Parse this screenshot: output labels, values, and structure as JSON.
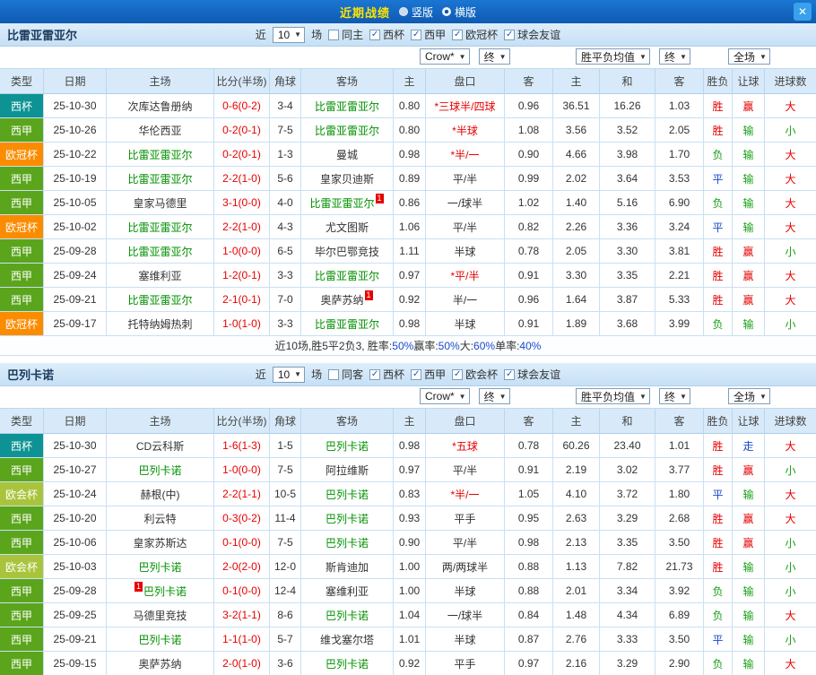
{
  "topbar": {
    "title": "近期战绩",
    "radios": [
      {
        "label": "竖版",
        "selected": false
      },
      {
        "label": "横版",
        "selected": true
      }
    ],
    "close_icon": "✕"
  },
  "table_headers": [
    "类型",
    "日期",
    "主场",
    "比分(半场)",
    "角球",
    "客场",
    "主",
    "盘口",
    "客",
    "主",
    "和",
    "客",
    "胜负",
    "让球",
    "进球数"
  ],
  "colors": {
    "win_red": "#e60000",
    "lose_green": "#16a016",
    "draw_blue": "#1a49cc",
    "focus_team_green": "#009000",
    "badge_cup": "#0d9394",
    "badge_liga": "#5ba51c",
    "badge_ucl": "#fb8c00",
    "badge_uecl": "#a9c43c",
    "title_yellow": "#ffe400"
  },
  "sections": [
    {
      "team": "比雷亚雷亚尔",
      "filters": {
        "near_label": "近",
        "count": "10",
        "games_label": "场",
        "same": {
          "label": "同主",
          "checked": false
        },
        "leagues": [
          {
            "label": "西杯",
            "checked": true
          },
          {
            "label": "西甲",
            "checked": true
          },
          {
            "label": "欧冠杯",
            "checked": true
          },
          {
            "label": "球会友谊",
            "checked": true
          }
        ]
      },
      "dropdowns": {
        "company": "Crow*",
        "final_asian": "终",
        "avg": "胜平负均值",
        "final_euro": "终",
        "scope": "全场"
      },
      "rows": [
        {
          "type": "西杯",
          "tcls": "cup",
          "date": "25-10-30",
          "home": "次库达鲁册纳",
          "hf": false,
          "hpre": "",
          "hpost": "",
          "score": "0-6(0-2)",
          "corner": "3-4",
          "away": "比雷亚雷亚尔",
          "af": true,
          "apre": "",
          "apost": "",
          "ah": "0.80",
          "hc": "*三球半/四球",
          "hcr": true,
          "aa": "0.96",
          "eh": "36.51",
          "ed": "16.26",
          "ea": "1.03",
          "res": "胜",
          "resc": "r",
          "let": "赢",
          "letc": "r",
          "goal": "大",
          "goalc": "r"
        },
        {
          "type": "西甲",
          "tcls": "liga",
          "date": "25-10-26",
          "home": "华伦西亚",
          "hf": false,
          "hpre": "",
          "hpost": "",
          "score": "0-2(0-1)",
          "corner": "7-5",
          "away": "比雷亚雷亚尔",
          "af": true,
          "apre": "",
          "apost": "",
          "ah": "0.80",
          "hc": "*半球",
          "hcr": true,
          "aa": "1.08",
          "eh": "3.56",
          "ed": "3.52",
          "ea": "2.05",
          "res": "胜",
          "resc": "r",
          "let": "输",
          "letc": "g",
          "goal": "小",
          "goalc": "g"
        },
        {
          "type": "欧冠杯",
          "tcls": "ucl",
          "date": "25-10-22",
          "home": "比雷亚雷亚尔",
          "hf": true,
          "hpre": "",
          "hpost": "",
          "score": "0-2(0-1)",
          "corner": "1-3",
          "away": "曼城",
          "af": false,
          "apre": "",
          "apost": "",
          "ah": "0.98",
          "hc": "*半/一",
          "hcr": true,
          "aa": "0.90",
          "eh": "4.66",
          "ed": "3.98",
          "ea": "1.70",
          "res": "负",
          "resc": "g",
          "let": "输",
          "letc": "g",
          "goal": "大",
          "goalc": "r"
        },
        {
          "type": "西甲",
          "tcls": "liga",
          "date": "25-10-19",
          "home": "比雷亚雷亚尔",
          "hf": true,
          "hpre": "",
          "hpost": "",
          "score": "2-2(1-0)",
          "corner": "5-6",
          "away": "皇家贝迪斯",
          "af": false,
          "apre": "",
          "apost": "",
          "ah": "0.89",
          "hc": "平/半",
          "hcr": false,
          "aa": "0.99",
          "eh": "2.02",
          "ed": "3.64",
          "ea": "3.53",
          "res": "平",
          "resc": "b",
          "let": "输",
          "letc": "g",
          "goal": "大",
          "goalc": "r"
        },
        {
          "type": "西甲",
          "tcls": "liga",
          "date": "25-10-05",
          "home": "皇家马德里",
          "hf": false,
          "hpre": "",
          "hpost": "",
          "score": "3-1(0-0)",
          "corner": "4-0",
          "away": "比雷亚雷亚尔",
          "af": true,
          "apre": "",
          "apost": "1",
          "ah": "0.86",
          "hc": "一/球半",
          "hcr": false,
          "aa": "1.02",
          "eh": "1.40",
          "ed": "5.16",
          "ea": "6.90",
          "res": "负",
          "resc": "g",
          "let": "输",
          "letc": "g",
          "goal": "大",
          "goalc": "r"
        },
        {
          "type": "欧冠杯",
          "tcls": "ucl",
          "date": "25-10-02",
          "home": "比雷亚雷亚尔",
          "hf": true,
          "hpre": "",
          "hpost": "",
          "score": "2-2(1-0)",
          "corner": "4-3",
          "away": "尤文图斯",
          "af": false,
          "apre": "",
          "apost": "",
          "ah": "1.06",
          "hc": "平/半",
          "hcr": false,
          "aa": "0.82",
          "eh": "2.26",
          "ed": "3.36",
          "ea": "3.24",
          "res": "平",
          "resc": "b",
          "let": "输",
          "letc": "g",
          "goal": "大",
          "goalc": "r"
        },
        {
          "type": "西甲",
          "tcls": "liga",
          "date": "25-09-28",
          "home": "比雷亚雷亚尔",
          "hf": true,
          "hpre": "",
          "hpost": "",
          "score": "1-0(0-0)",
          "corner": "6-5",
          "away": "毕尔巴鄂竞技",
          "af": false,
          "apre": "",
          "apost": "",
          "ah": "1.11",
          "hc": "半球",
          "hcr": false,
          "aa": "0.78",
          "eh": "2.05",
          "ed": "3.30",
          "ea": "3.81",
          "res": "胜",
          "resc": "r",
          "let": "赢",
          "letc": "r",
          "goal": "小",
          "goalc": "g"
        },
        {
          "type": "西甲",
          "tcls": "liga",
          "date": "25-09-24",
          "home": "塞维利亚",
          "hf": false,
          "hpre": "",
          "hpost": "",
          "score": "1-2(0-1)",
          "corner": "3-3",
          "away": "比雷亚雷亚尔",
          "af": true,
          "apre": "",
          "apost": "",
          "ah": "0.97",
          "hc": "*平/半",
          "hcr": true,
          "aa": "0.91",
          "eh": "3.30",
          "ed": "3.35",
          "ea": "2.21",
          "res": "胜",
          "resc": "r",
          "let": "赢",
          "letc": "r",
          "goal": "大",
          "goalc": "r"
        },
        {
          "type": "西甲",
          "tcls": "liga",
          "date": "25-09-21",
          "home": "比雷亚雷亚尔",
          "hf": true,
          "hpre": "",
          "hpost": "",
          "score": "2-1(0-1)",
          "corner": "7-0",
          "away": "奥萨苏纳",
          "af": false,
          "apre": "",
          "apost": "1",
          "ah": "0.92",
          "hc": "半/一",
          "hcr": false,
          "aa": "0.96",
          "eh": "1.64",
          "ed": "3.87",
          "ea": "5.33",
          "res": "胜",
          "resc": "r",
          "let": "赢",
          "letc": "r",
          "goal": "大",
          "goalc": "r"
        },
        {
          "type": "欧冠杯",
          "tcls": "ucl",
          "date": "25-09-17",
          "home": "托特纳姆热刺",
          "hf": false,
          "hpre": "",
          "hpost": "",
          "score": "1-0(1-0)",
          "corner": "3-3",
          "away": "比雷亚雷亚尔",
          "af": true,
          "apre": "",
          "apost": "",
          "ah": "0.98",
          "hc": "半球",
          "hcr": false,
          "aa": "0.91",
          "eh": "1.89",
          "ed": "3.68",
          "ea": "3.99",
          "res": "负",
          "resc": "g",
          "let": "输",
          "letc": "g",
          "goal": "小",
          "goalc": "g"
        }
      ],
      "summary": [
        {
          "text": "近10场,胜5平2负3, 胜率:",
          "cls": "dark"
        },
        {
          "text": "50%",
          "cls": "blue"
        },
        {
          "text": " 赢率:",
          "cls": "dark"
        },
        {
          "text": "50%",
          "cls": "blue"
        },
        {
          "text": " 大:",
          "cls": "dark"
        },
        {
          "text": "60%",
          "cls": "blue"
        },
        {
          "text": " 单率:",
          "cls": "dark"
        },
        {
          "text": "40%",
          "cls": "blue"
        }
      ]
    },
    {
      "team": "巴列卡诺",
      "filters": {
        "near_label": "近",
        "count": "10",
        "games_label": "场",
        "same": {
          "label": "同客",
          "checked": false
        },
        "leagues": [
          {
            "label": "西杯",
            "checked": true
          },
          {
            "label": "西甲",
            "checked": true
          },
          {
            "label": "欧会杯",
            "checked": true
          },
          {
            "label": "球会友谊",
            "checked": true
          }
        ]
      },
      "dropdowns": {
        "company": "Crow*",
        "final_asian": "终",
        "avg": "胜平负均值",
        "final_euro": "终",
        "scope": "全场"
      },
      "rows": [
        {
          "type": "西杯",
          "tcls": "cup",
          "date": "25-10-30",
          "home": "CD云科斯",
          "hf": false,
          "hpre": "",
          "hpost": "",
          "score": "1-6(1-3)",
          "corner": "1-5",
          "away": "巴列卡诺",
          "af": true,
          "apre": "",
          "apost": "",
          "ah": "0.98",
          "hc": "*五球",
          "hcr": true,
          "aa": "0.78",
          "eh": "60.26",
          "ed": "23.40",
          "ea": "1.01",
          "res": "胜",
          "resc": "r",
          "let": "走",
          "letc": "b",
          "goal": "大",
          "goalc": "r"
        },
        {
          "type": "西甲",
          "tcls": "liga",
          "date": "25-10-27",
          "home": "巴列卡诺",
          "hf": true,
          "hpre": "",
          "hpost": "",
          "score": "1-0(0-0)",
          "corner": "7-5",
          "away": "阿拉维斯",
          "af": false,
          "apre": "",
          "apost": "",
          "ah": "0.97",
          "hc": "平/半",
          "hcr": false,
          "aa": "0.91",
          "eh": "2.19",
          "ed": "3.02",
          "ea": "3.77",
          "res": "胜",
          "resc": "r",
          "let": "赢",
          "letc": "r",
          "goal": "小",
          "goalc": "g"
        },
        {
          "type": "欧会杯",
          "tcls": "uecl",
          "date": "25-10-24",
          "home": "赫根(中)",
          "hf": false,
          "hpre": "",
          "hpost": "",
          "score": "2-2(1-1)",
          "corner": "10-5",
          "away": "巴列卡诺",
          "af": true,
          "apre": "",
          "apost": "",
          "ah": "0.83",
          "hc": "*半/一",
          "hcr": true,
          "aa": "1.05",
          "eh": "4.10",
          "ed": "3.72",
          "ea": "1.80",
          "res": "平",
          "resc": "b",
          "let": "输",
          "letc": "g",
          "goal": "大",
          "goalc": "r"
        },
        {
          "type": "西甲",
          "tcls": "liga",
          "date": "25-10-20",
          "home": "利云特",
          "hf": false,
          "hpre": "",
          "hpost": "",
          "score": "0-3(0-2)",
          "corner": "11-4",
          "away": "巴列卡诺",
          "af": true,
          "apre": "",
          "apost": "",
          "ah": "0.93",
          "hc": "平手",
          "hcr": false,
          "aa": "0.95",
          "eh": "2.63",
          "ed": "3.29",
          "ea": "2.68",
          "res": "胜",
          "resc": "r",
          "let": "赢",
          "letc": "r",
          "goal": "大",
          "goalc": "r"
        },
        {
          "type": "西甲",
          "tcls": "liga",
          "date": "25-10-06",
          "home": "皇家苏斯达",
          "hf": false,
          "hpre": "",
          "hpost": "",
          "score": "0-1(0-0)",
          "corner": "7-5",
          "away": "巴列卡诺",
          "af": true,
          "apre": "",
          "apost": "",
          "ah": "0.90",
          "hc": "平/半",
          "hcr": false,
          "aa": "0.98",
          "eh": "2.13",
          "ed": "3.35",
          "ea": "3.50",
          "res": "胜",
          "resc": "r",
          "let": "赢",
          "letc": "r",
          "goal": "小",
          "goalc": "g"
        },
        {
          "type": "欧会杯",
          "tcls": "uecl",
          "date": "25-10-03",
          "home": "巴列卡诺",
          "hf": true,
          "hpre": "",
          "hpost": "",
          "score": "2-0(2-0)",
          "corner": "12-0",
          "away": "斯肯迪加",
          "af": false,
          "apre": "",
          "apost": "",
          "ah": "1.00",
          "hc": "两/两球半",
          "hcr": false,
          "aa": "0.88",
          "eh": "1.13",
          "ed": "7.82",
          "ea": "21.73",
          "res": "胜",
          "resc": "r",
          "let": "输",
          "letc": "g",
          "goal": "小",
          "goalc": "g"
        },
        {
          "type": "西甲",
          "tcls": "liga",
          "date": "25-09-28",
          "home": "巴列卡诺",
          "hf": true,
          "hpre": "1",
          "hpost": "",
          "score": "0-1(0-0)",
          "corner": "12-4",
          "away": "塞维利亚",
          "af": false,
          "apre": "",
          "apost": "",
          "ah": "1.00",
          "hc": "半球",
          "hcr": false,
          "aa": "0.88",
          "eh": "2.01",
          "ed": "3.34",
          "ea": "3.92",
          "res": "负",
          "resc": "g",
          "let": "输",
          "letc": "g",
          "goal": "小",
          "goalc": "g"
        },
        {
          "type": "西甲",
          "tcls": "liga",
          "date": "25-09-25",
          "home": "马德里竞技",
          "hf": false,
          "hpre": "",
          "hpost": "",
          "score": "3-2(1-1)",
          "corner": "8-6",
          "away": "巴列卡诺",
          "af": true,
          "apre": "",
          "apost": "",
          "ah": "1.04",
          "hc": "一/球半",
          "hcr": false,
          "aa": "0.84",
          "eh": "1.48",
          "ed": "4.34",
          "ea": "6.89",
          "res": "负",
          "resc": "g",
          "let": "输",
          "letc": "g",
          "goal": "大",
          "goalc": "r"
        },
        {
          "type": "西甲",
          "tcls": "liga",
          "date": "25-09-21",
          "home": "巴列卡诺",
          "hf": true,
          "hpre": "",
          "hpost": "",
          "score": "1-1(1-0)",
          "corner": "5-7",
          "away": "维戈塞尔塔",
          "af": false,
          "apre": "",
          "apost": "",
          "ah": "1.01",
          "hc": "半球",
          "hcr": false,
          "aa": "0.87",
          "eh": "2.76",
          "ed": "3.33",
          "ea": "3.50",
          "res": "平",
          "resc": "b",
          "let": "输",
          "letc": "g",
          "goal": "小",
          "goalc": "g"
        },
        {
          "type": "西甲",
          "tcls": "liga",
          "date": "25-09-15",
          "home": "奥萨苏纳",
          "hf": false,
          "hpre": "",
          "hpost": "",
          "score": "2-0(1-0)",
          "corner": "3-6",
          "away": "巴列卡诺",
          "af": true,
          "apre": "",
          "apost": "",
          "ah": "0.92",
          "hc": "平手",
          "hcr": false,
          "aa": "0.97",
          "eh": "2.16",
          "ed": "3.29",
          "ea": "2.90",
          "res": "负",
          "resc": "g",
          "let": "输",
          "letc": "g",
          "goal": "大",
          "goalc": "r"
        }
      ],
      "summary": []
    }
  ]
}
